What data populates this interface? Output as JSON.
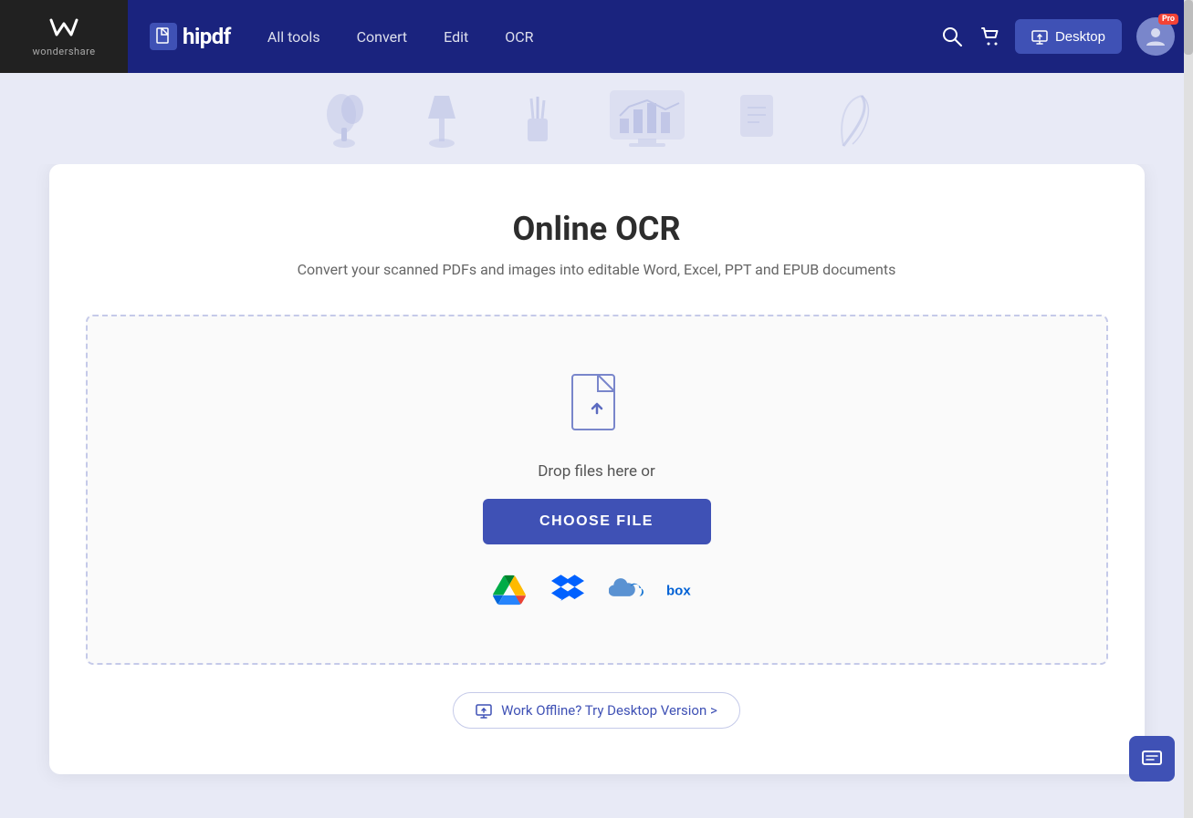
{
  "brand": {
    "wondershare_label": "wondershare",
    "hipdf_label": "hipdf"
  },
  "navbar": {
    "all_tools": "All tools",
    "convert": "Convert",
    "edit": "Edit",
    "ocr": "OCR",
    "desktop_btn": "Desktop",
    "pro_badge": "Pro"
  },
  "page": {
    "title": "Online OCR",
    "subtitle": "Convert your scanned PDFs and images into editable Word, Excel, PPT and EPUB documents"
  },
  "dropzone": {
    "drop_text": "Drop files here or",
    "choose_file_btn": "CHOOSE FILE"
  },
  "cloud_providers": [
    {
      "id": "google-drive",
      "label": "Google Drive"
    },
    {
      "id": "dropbox",
      "label": "Dropbox"
    },
    {
      "id": "onedrive",
      "label": "OneDrive"
    },
    {
      "id": "box",
      "label": "Box"
    }
  ],
  "offline_banner": {
    "text": "Work Offline? Try Desktop Version >"
  },
  "icons": {
    "search": "🔍",
    "cart": "🛒",
    "desktop_icon": "⬆",
    "chat": "✉",
    "upload_arrow": "⬆"
  }
}
